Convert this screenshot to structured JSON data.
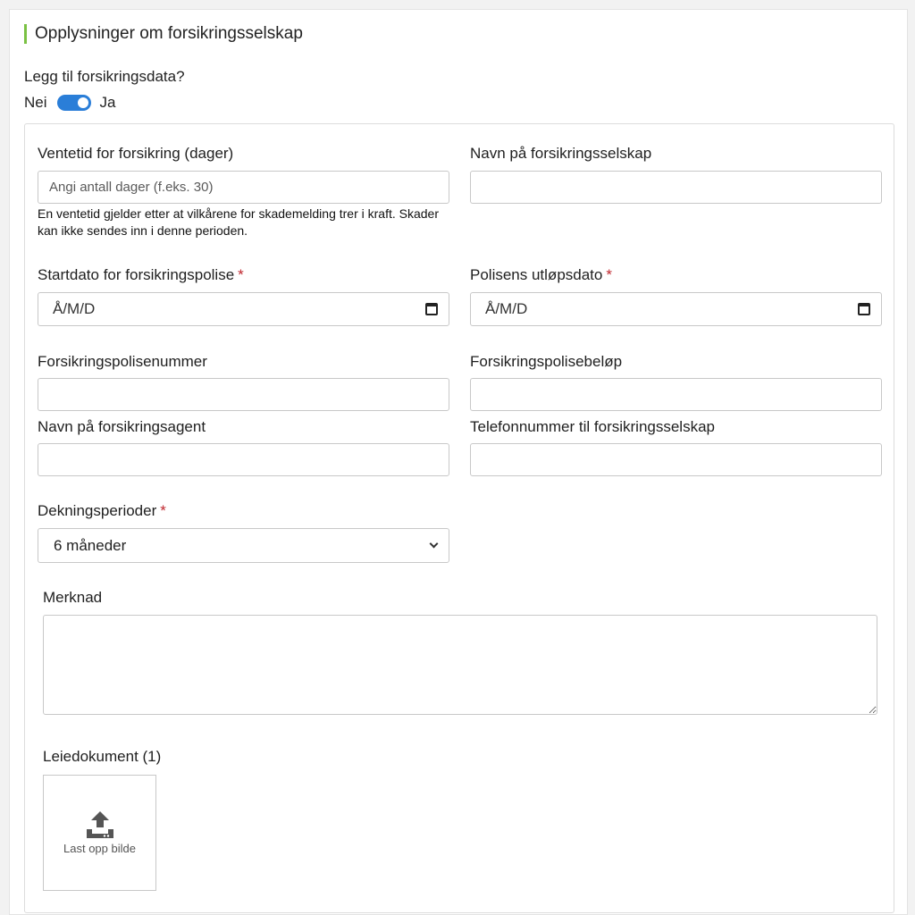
{
  "section": {
    "title": "Opplysninger om forsikringsselskap",
    "question": "Legg til forsikringsdata?",
    "toggle_off_label": "Nei",
    "toggle_on_label": "Ja",
    "toggle_on": true
  },
  "form": {
    "waiting_period": {
      "label": "Ventetid for forsikring (dager)",
      "placeholder": "Angi antall dager (f.eks. 30)",
      "help": "En ventetid gjelder etter at vilkårene for skademelding trer i kraft. Skader kan ikke sendes inn i denne perioden."
    },
    "company_name": {
      "label": "Navn på forsikringsselskap",
      "value": ""
    },
    "start_date": {
      "label": "Startdato for forsikringspolise",
      "required_mark": "*",
      "placeholder": "Å/M/D"
    },
    "expiry_date": {
      "label": "Polisens utløpsdato",
      "required_mark": "*",
      "placeholder": "Å/M/D"
    },
    "policy_number": {
      "label": "Forsikringspolisenummer",
      "value": ""
    },
    "policy_amount": {
      "label": "Forsikringspolisebeløp",
      "value": ""
    },
    "agent_name": {
      "label": "Navn på forsikringsagent",
      "value": ""
    },
    "company_phone": {
      "label": "Telefonnummer til forsikringsselskap",
      "value": ""
    },
    "coverage": {
      "label": "Dekningsperioder",
      "required_mark": "*",
      "selected": "6 måneder"
    },
    "remark": {
      "label": "Merknad",
      "value": ""
    },
    "lease_document": {
      "label": "Leiedokument (1)",
      "upload_text": "Last opp bilde",
      "icon": "upload-icon"
    }
  },
  "colors": {
    "accent_bar": "#7ac143",
    "toggle": "#2a7ed8",
    "required": "#c0282f"
  }
}
